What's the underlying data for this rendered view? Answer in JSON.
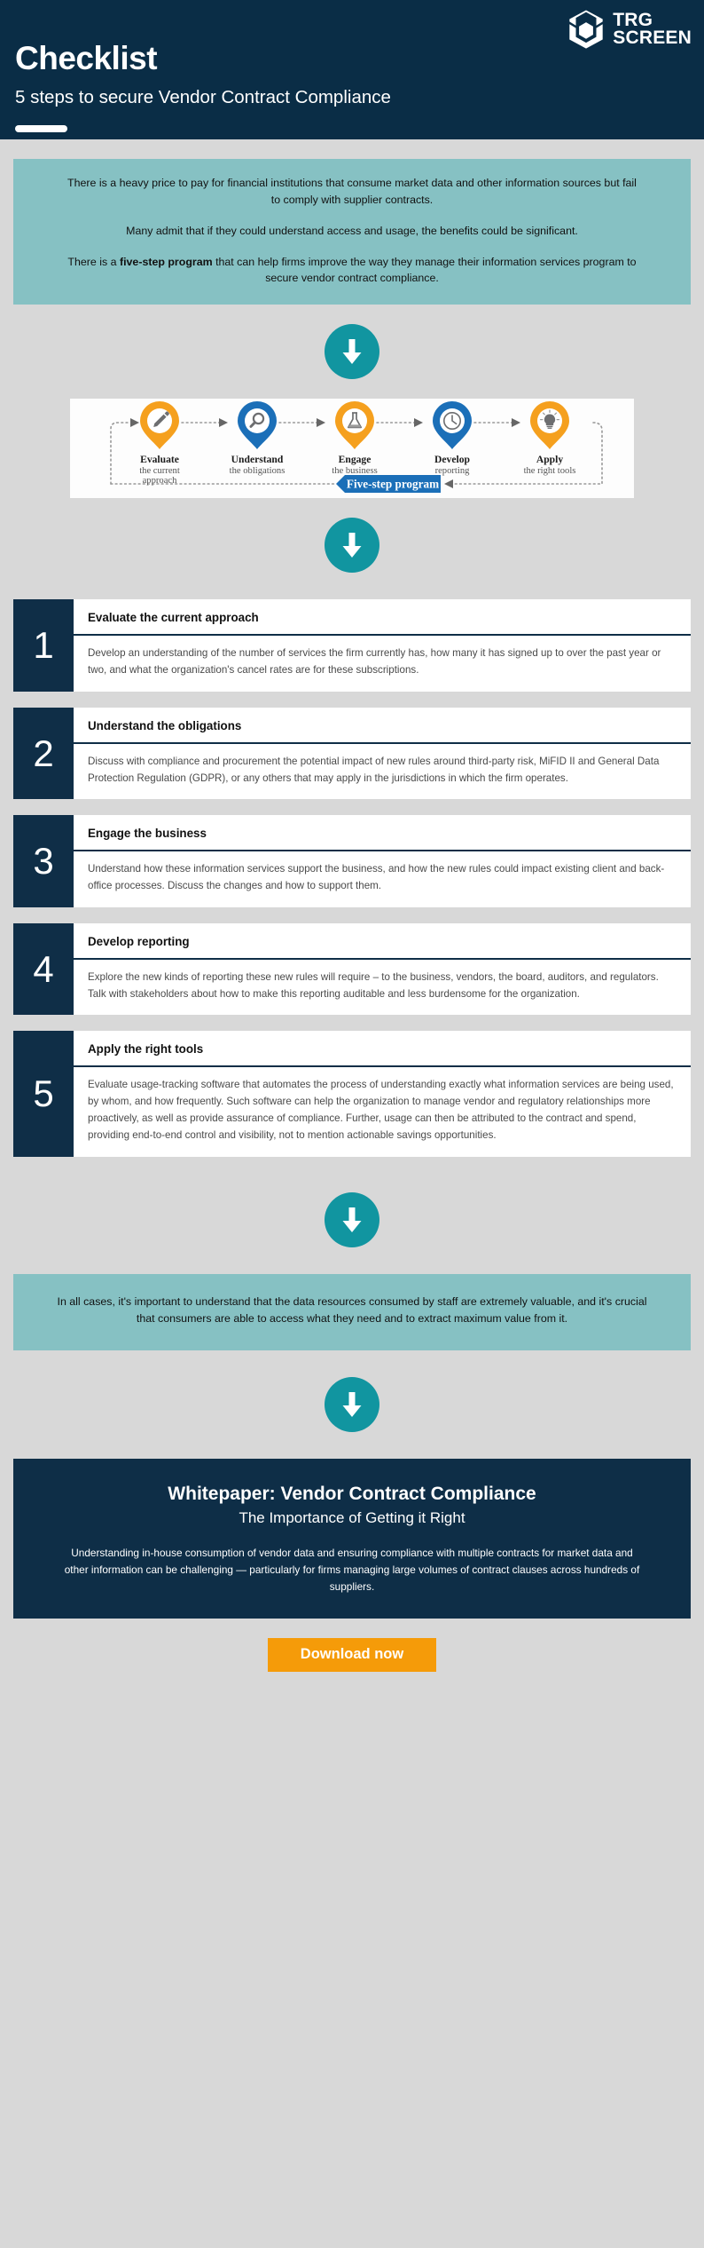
{
  "header": {
    "title": "Checklist",
    "subtitle": "5 steps to secure Vendor Contract Compliance",
    "logo": {
      "line1": "TRG",
      "line2": "SCREEN"
    }
  },
  "intro": {
    "para1": "There is a heavy price to pay for financial institutions that consume market data and other information sources but fail to comply with supplier contracts.",
    "para2": "Many admit that if they could understand access and usage, the benefits could be significant.",
    "para3_pre": "There is a ",
    "para3_bold": "five-step program",
    "para3_post": " that can help firms improve the way they manage their information services program to secure vendor contract compliance."
  },
  "diagram": {
    "badge_label": "Five-step program",
    "steps": [
      {
        "icon": "pencil-icon",
        "color": "#f5a01e",
        "title": "Evaluate",
        "sub_line1": "the current",
        "sub_line2": "approach"
      },
      {
        "icon": "magnifier-icon",
        "color": "#1b6fb8",
        "title": "Understand",
        "sub_line1": "the obligations",
        "sub_line2": ""
      },
      {
        "icon": "flask-icon",
        "color": "#f5a01e",
        "title": "Engage",
        "sub_line1": "the business",
        "sub_line2": ""
      },
      {
        "icon": "clock-icon",
        "color": "#1b6fb8",
        "title": "Develop",
        "sub_line1": "reporting",
        "sub_line2": ""
      },
      {
        "icon": "bulb-icon",
        "color": "#f5a01e",
        "title": "Apply",
        "sub_line1": "the right tools",
        "sub_line2": ""
      }
    ]
  },
  "steps": [
    {
      "number": "1",
      "title": "Evaluate the current approach",
      "text": "Develop an understanding of the number of services the firm currently has, how many it has signed up to over the past year or two, and what the organization's cancel rates are for these subscriptions."
    },
    {
      "number": "2",
      "title": "Understand the obligations",
      "text": "Discuss with compliance and procurement the potential impact of new rules around third-party risk, MiFID II and General Data Protection Regulation (GDPR), or any others that may apply in the jurisdictions in which the firm operates."
    },
    {
      "number": "3",
      "title": "Engage the business",
      "text": "Understand how these information services support the business, and how the new rules could impact existing client and back-office processes. Discuss the changes and how to support them."
    },
    {
      "number": "4",
      "title": "Develop reporting",
      "text": "Explore the new kinds of reporting these new rules will require – to the business, vendors, the board, auditors, and regulators. Talk with stakeholders about how to make this reporting auditable and less burdensome for the organization."
    },
    {
      "number": "5",
      "title": "Apply the right tools",
      "text": "Evaluate usage-tracking software that automates the process of understanding exactly what information services are being used, by whom, and how frequently. Such software can help the organization to manage vendor and regulatory relationships more proactively, as well as provide assurance of compliance. Further, usage can then be attributed to the contract and spend, providing end-to-end control and visibility, not to mention actionable savings opportunities."
    }
  ],
  "closing": {
    "text": "In all cases, it's important to understand that the data resources consumed by staff are extremely valuable, and it's crucial that consumers are able to access what they need and to extract maximum value from it."
  },
  "whitepaper": {
    "title": "Whitepaper: Vendor Contract Compliance",
    "subtitle": "The Importance of Getting it Right",
    "body": "Understanding in-house consumption of vendor data and ensuring compliance with multiple contracts for market data and other information can be challenging — particularly for firms managing large volumes of contract clauses across hundreds of suppliers.",
    "cta_label": "Download now"
  },
  "colors": {
    "navy": "#0a2d46",
    "teal_block": "#86c1c3",
    "teal_circle": "#1195a0",
    "orange": "#f5a01e",
    "blue": "#1b6fb8",
    "cta_orange": "#f59b09",
    "page_bg": "#d8d8d8"
  }
}
